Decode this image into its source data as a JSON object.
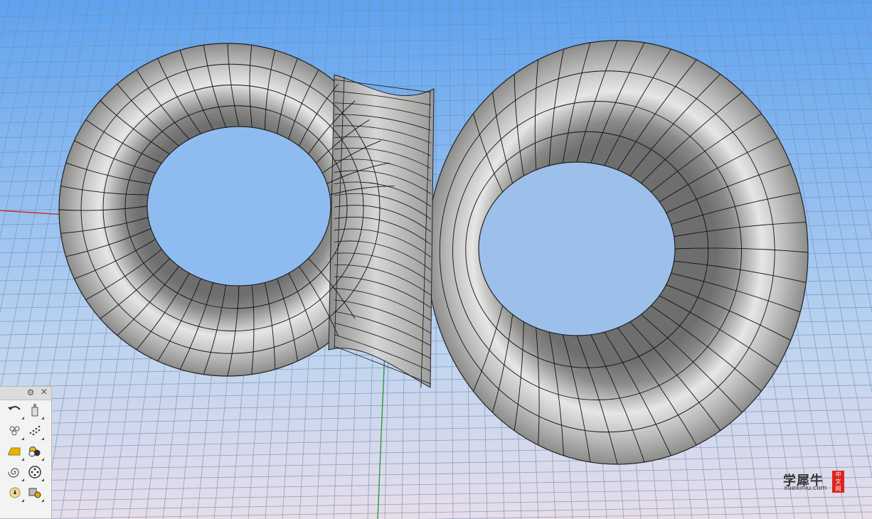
{
  "viewport": {
    "name": "perspective-viewport",
    "background_top": "#5ea2ee",
    "background_bottom": "#e7dde9",
    "grid_color": "#6f8fb8",
    "x_axis_color": "#c03030",
    "y_axis_color": "#2f9a3a",
    "model_color": "#b9b9b7",
    "isocurve_color": "#111111"
  },
  "toolbar": {
    "icons": [
      [
        "unknown-icon",
        "undo-icon",
        "paint-bottle-icon"
      ],
      [
        "unknown-icon",
        "point-cloud-icon",
        "dot-grid-icon"
      ],
      [
        "unknown-icon",
        "folder-icon",
        "render-spheres-icon"
      ],
      [
        "unknown-icon",
        "spiral-icon",
        "camera-target-icon"
      ],
      [
        "unknown-icon",
        "light-icon",
        "material-icon"
      ]
    ]
  },
  "watermark": {
    "title": "学犀牛",
    "url": "xuexiniu.com",
    "stamp": [
      "中",
      "文",
      "网"
    ],
    "stamp_color": "#dd2222"
  }
}
